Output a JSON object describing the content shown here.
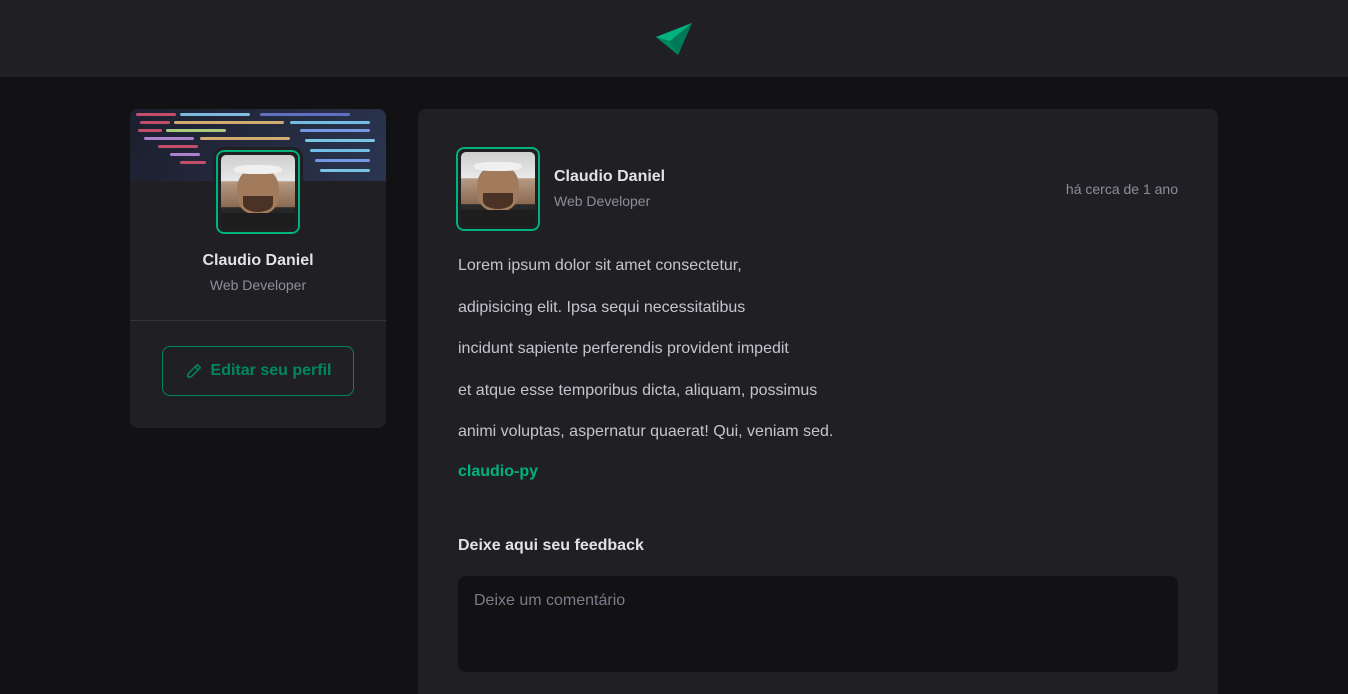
{
  "header": {
    "logo_icon": "paper-plane-logo-icon",
    "accent": "#00b37e"
  },
  "sidebar": {
    "name": "Claudio Daniel",
    "role": "Web Developer",
    "edit_button_label": "Editar seu perfil",
    "edit_icon": "pencil-icon"
  },
  "post": {
    "author": {
      "name": "Claudio Daniel",
      "role": "Web Developer"
    },
    "published": "há cerca de 1 ano",
    "paragraphs": [
      "Lorem ipsum dolor sit amet consectetur,",
      "adipisicing elit. Ipsa sequi necessitatibus",
      "incidunt sapiente perferendis provident impedit",
      "et atque esse temporibus dicta, aliquam, possimus",
      "animi voluptas, aspernatur quaerat! Qui, veniam sed."
    ],
    "link": "claudio-py",
    "feedback": {
      "title": "Deixe aqui seu feedback",
      "placeholder": "Deixe um comentário"
    }
  },
  "colors": {
    "background": "#121214",
    "card": "#202024",
    "green": "#00875f",
    "green_light": "#00b37e",
    "text": "#e1e1e6",
    "muted": "#8d8d99"
  }
}
